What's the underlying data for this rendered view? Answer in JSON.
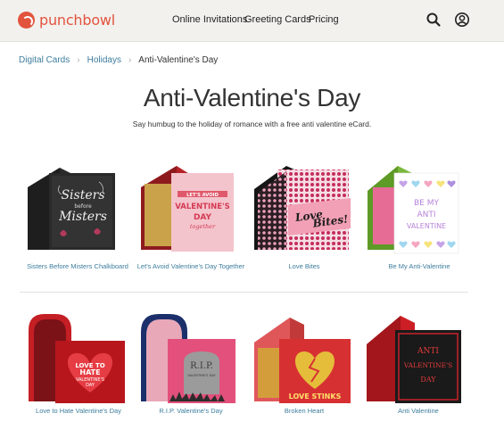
{
  "header": {
    "brand": "punchbowl",
    "nav": [
      "Online Invitations",
      "Greeting Cards",
      "Pricing"
    ],
    "icons": [
      "search-icon",
      "account-icon"
    ]
  },
  "breadcrumb": {
    "items": [
      "Digital Cards",
      "Holidays"
    ],
    "current": "Anti-Valentine's Day"
  },
  "main": {
    "title": "Anti-Valentine's Day",
    "subtitle": "Say humbug to the holiday of romance with a free anti valentine eCard."
  },
  "cards": [
    {
      "label": "Sisters Before Misters Chalkboard",
      "art": {
        "lines": [
          "Sisters",
          "before",
          "Misters"
        ]
      }
    },
    {
      "label": "Let's Avoid Valentine's Day Together",
      "art": {
        "lines": [
          "LET'S AVOID",
          "VALENTINE'S",
          "DAY",
          "together"
        ]
      }
    },
    {
      "label": "Love Bites",
      "art": {
        "lines": [
          "Love",
          "Bites!"
        ]
      }
    },
    {
      "label": "Be My Anti-Valentine",
      "art": {
        "lines": [
          "BE MY",
          "ANTI",
          "VALENTINE"
        ]
      }
    },
    {
      "label": "Love to Hate Valentine's Day",
      "art": {
        "lines": [
          "LOVE TO",
          "HATE",
          "VALENTINE'S",
          "DAY"
        ]
      }
    },
    {
      "label": "R.I.P. Valentine's Day",
      "art": {
        "lines": [
          "R.I.P.",
          "VALENTINE'S DAY"
        ]
      }
    },
    {
      "label": "Broken Heart",
      "art": {
        "lines": [
          "LOVE STINKS"
        ]
      }
    },
    {
      "label": "Anti Valentine",
      "art": {
        "lines": [
          "ANTI",
          "VALENTINE'S",
          "DAY"
        ]
      }
    }
  ],
  "colors": {
    "brand": "#e2543d",
    "link": "#3d7d9c",
    "header_bg": "#f2f1ee"
  }
}
